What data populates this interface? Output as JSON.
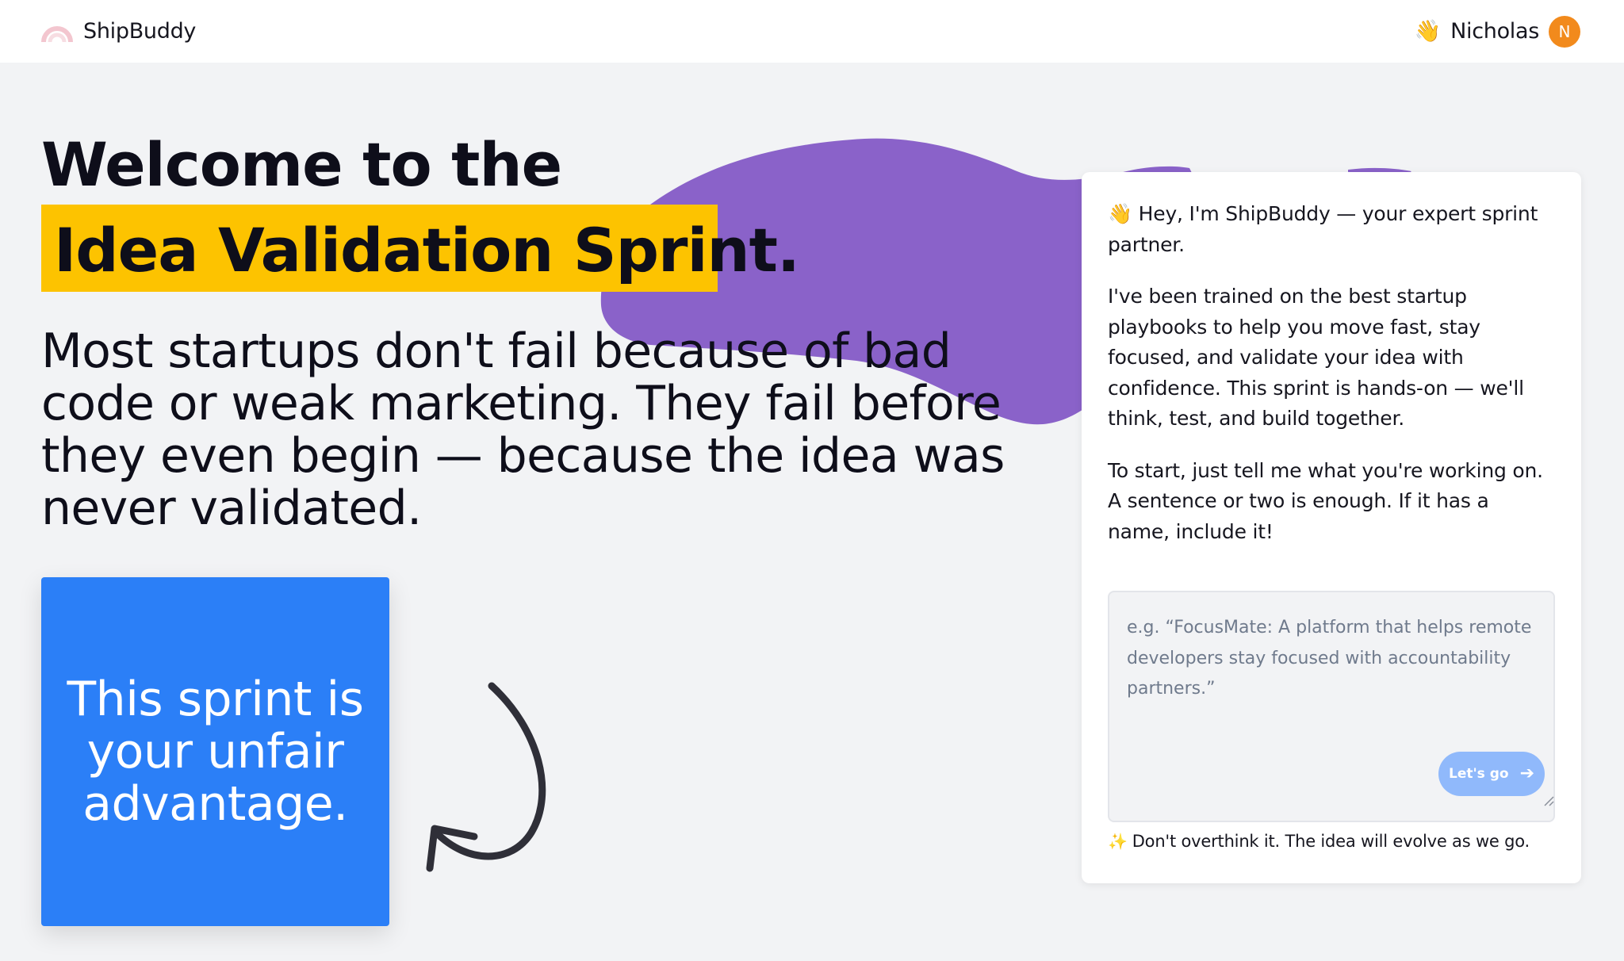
{
  "header": {
    "brand_name": "ShipBuddy",
    "logo_icon": "rainbow-arch",
    "user_wave": "👋",
    "user_name": "Nicholas",
    "avatar_initial": "N"
  },
  "hero": {
    "title_line1": "Welcome to the",
    "title_line2": "Idea Validation Sprint.",
    "subtitle": "Most startups don't fail because of bad code or weak marketing. They fail before they even begin — because the idea was never validated.",
    "card_text": "This sprint is your unfair advantage."
  },
  "chat": {
    "intro": "👋 Hey, I'm ShipBuddy — your expert sprint partner.",
    "body": "I've been trained on the best startup playbooks to help you move fast, stay focused, and validate your idea with confidence. This sprint is hands-on — we'll think, test, and build together.",
    "prompt": "To start, just tell me what you're working on. A sentence or two is enough. If it has a name, include it!",
    "input_placeholder": "e.g. “FocusMate: A platform that helps remote developers stay focused with accountability partners.”",
    "input_value": "",
    "button_label": "Let's go",
    "button_icon": "arrow-right-icon",
    "hint_icon": "✨",
    "hint": "Don't overthink it. The idea will evolve as we go."
  },
  "colors": {
    "highlight": "#fdc300",
    "card_blue": "#2b7ff7",
    "brush_purple": "#8a62c9",
    "avatar_orange": "#f28a1c",
    "button_disabled_blue": "#90b9fb",
    "page_bg": "#f2f3f5"
  }
}
